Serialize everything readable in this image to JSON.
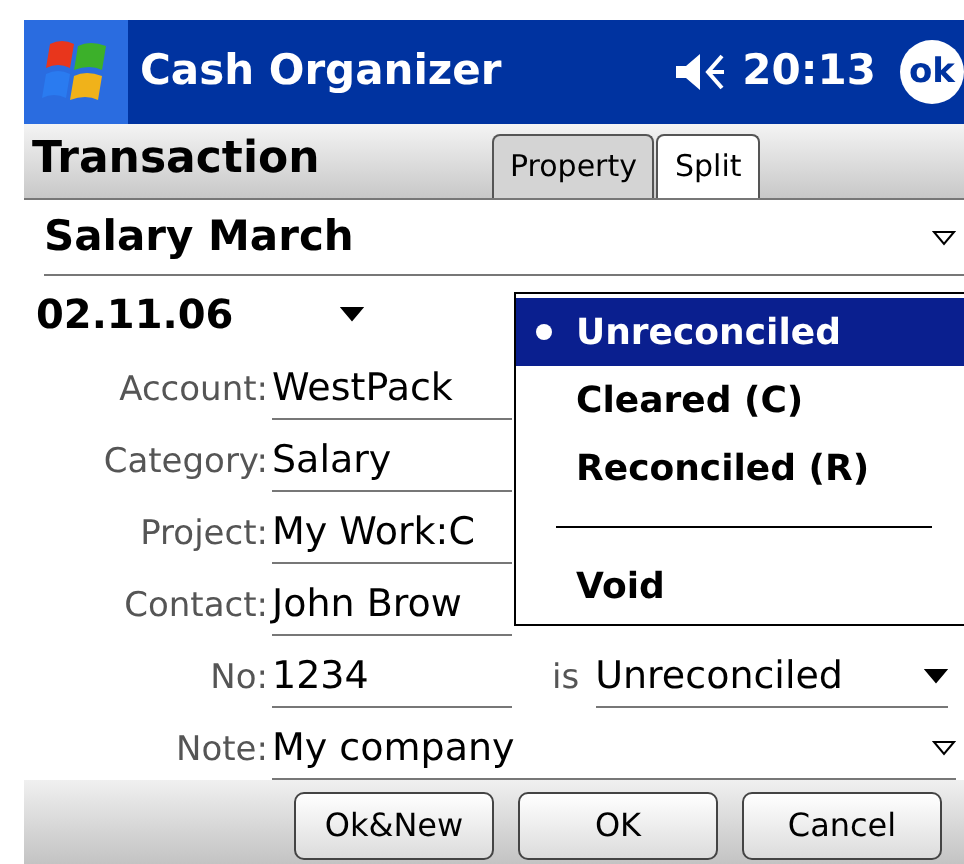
{
  "title_bar": {
    "title": "Cash Organizer",
    "time": "20:13",
    "ok": "ok"
  },
  "header": {
    "title": "Transaction",
    "tabs": [
      {
        "label": "Property",
        "selected": true
      },
      {
        "label": "Split",
        "selected": false
      }
    ]
  },
  "payee": "Salary March",
  "date": "02.11.06",
  "fields": [
    {
      "label": "Account:",
      "value": "WestPack"
    },
    {
      "label": "Category:",
      "value": "Salary"
    },
    {
      "label": "Project:",
      "value": "My Work:C"
    },
    {
      "label": "Contact:",
      "value": "John Brow"
    }
  ],
  "number": {
    "label": "No:",
    "value": "1234",
    "status_label": "is",
    "status": "Unreconciled"
  },
  "note": {
    "label": "Note:",
    "value": "My company"
  },
  "status_menu": [
    {
      "kind": "option",
      "label": "Unreconciled",
      "selected": true
    },
    {
      "kind": "option",
      "label": "Cleared (C)",
      "selected": false
    },
    {
      "kind": "option",
      "label": "Reconciled (R)",
      "selected": false
    },
    {
      "kind": "separator"
    },
    {
      "kind": "option",
      "label": "Void",
      "selected": false
    }
  ],
  "buttons": [
    "Ok&New",
    "OK",
    "Cancel"
  ]
}
